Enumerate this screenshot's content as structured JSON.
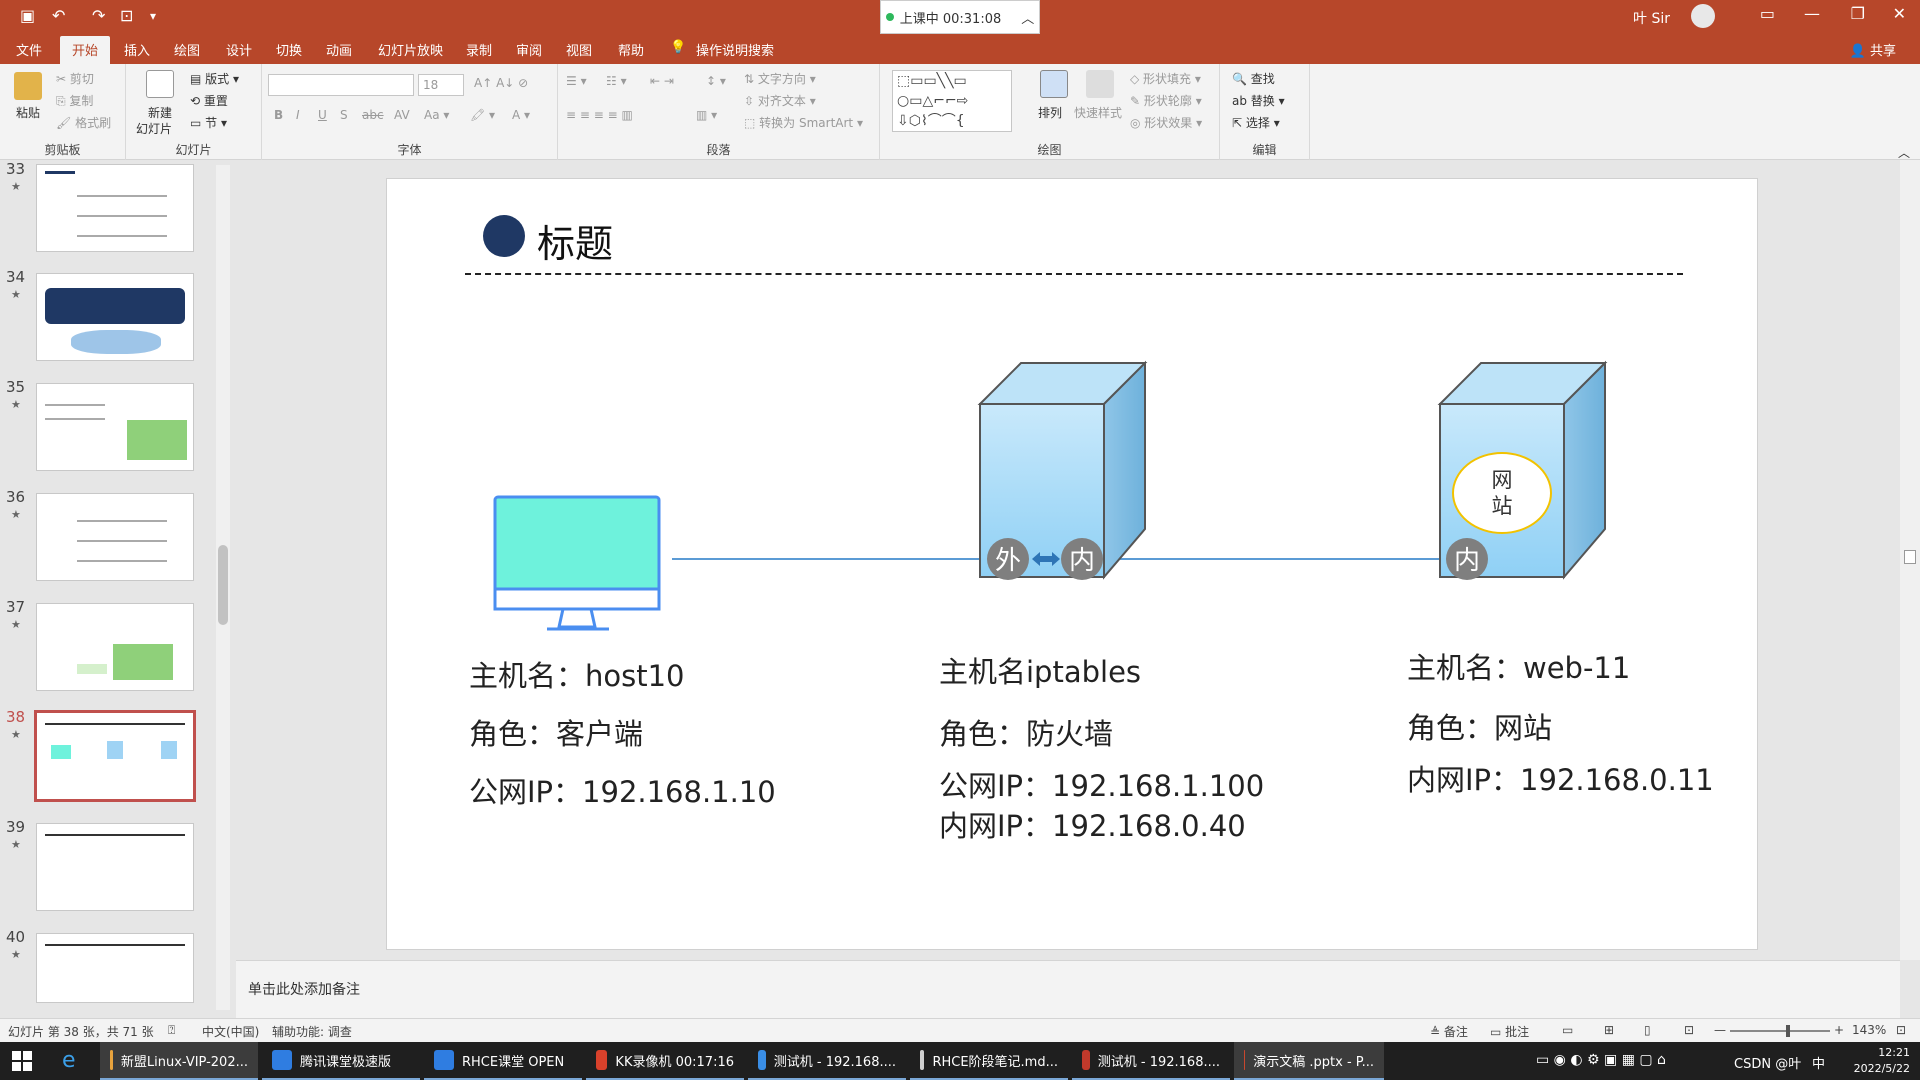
{
  "titlebar": {
    "live_label": "上课中 00:31:08",
    "user_name": "叶 Sir"
  },
  "menu_tabs": [
    {
      "label": "文件"
    },
    {
      "label": "开始"
    },
    {
      "label": "插入"
    },
    {
      "label": "绘图"
    },
    {
      "label": "设计"
    },
    {
      "label": "切换"
    },
    {
      "label": "动画"
    },
    {
      "label": "幻灯片放映"
    },
    {
      "label": "录制"
    },
    {
      "label": "审阅"
    },
    {
      "label": "视图"
    },
    {
      "label": "帮助"
    },
    {
      "label": "操作说明搜索"
    }
  ],
  "share_label": "共享",
  "ribbon": {
    "clipboard": {
      "paste": "粘贴",
      "cut": "剪切",
      "copy": "复制",
      "format_painter": "格式刷",
      "title": "剪贴板"
    },
    "slides": {
      "new_slide": "新建",
      "new_slide2": "幻灯片",
      "layout": "版式",
      "reset": "重置",
      "section": "节",
      "title": "幻灯片"
    },
    "font": {
      "size": "18",
      "title": "字体"
    },
    "paragraph": {
      "text_direction": "文字方向",
      "align_text": "对齐文本",
      "smartart": "转换为 SmartArt",
      "title": "段落"
    },
    "drawing": {
      "arrange": "排列",
      "quick_styles": "快速样式",
      "fill": "形状填充",
      "outline": "形状轮廓",
      "effects": "形状效果",
      "title": "绘图"
    },
    "editing": {
      "find": "查找",
      "replace": "替换",
      "select": "选择",
      "title": "编辑"
    }
  },
  "thumbnails": [
    {
      "number": "33"
    },
    {
      "number": "34"
    },
    {
      "number": "35"
    },
    {
      "number": "36"
    },
    {
      "number": "37"
    },
    {
      "number": "38"
    },
    {
      "number": "39"
    },
    {
      "number": "40"
    }
  ],
  "slide": {
    "title": "标题",
    "hosts": [
      {
        "name": "主机名：host10",
        "role": "角色：客户端",
        "ip1": "公网IP：192.168.1.10",
        "ip2": ""
      },
      {
        "name": "主机名iptables",
        "role": "角色：防火墙",
        "ip1": "公网IP：192.168.1.100",
        "ip2": "内网IP：192.168.0.40"
      },
      {
        "name": "主机名：web-11",
        "role": "角色：网站",
        "ip1": "内网IP：192.168.0.11",
        "ip2": ""
      }
    ],
    "firewall_outer": "外",
    "firewall_inner": "内",
    "web_inner": "内",
    "website_label_1": "网",
    "website_label_2": "站"
  },
  "notes_placeholder": "单击此处添加备注",
  "status": {
    "slide_info": "幻灯片 第 38 张，共 71 张",
    "language": "中文(中国)",
    "accessibility": "辅助功能: 调查",
    "notes": "备注",
    "comments": "批注",
    "zoom": "143%"
  },
  "taskbar": [
    {
      "label": "新盟Linux-VIP-202...",
      "color": "#e8a33d"
    },
    {
      "label": "腾讯课堂极速版",
      "color": "#2f7de1"
    },
    {
      "label": "RHCE课堂 OPEN",
      "color": "#2f7de1"
    },
    {
      "label": "KK录像机 00:17:16",
      "color": "#d9412b"
    },
    {
      "label": "测试机 - 192.168....",
      "color": "#3a8ee6"
    },
    {
      "label": "RHCE阶段笔记.md...",
      "color": "#d0d0d0"
    },
    {
      "label": "测试机 - 192.168....",
      "color": "#c0392b"
    },
    {
      "label": "演示文稿 .pptx - P...",
      "color": "#c8472e"
    }
  ],
  "tray": {
    "time": "12:21",
    "date": "2022/5/22",
    "ime": "CSDN @叶",
    "ime2": "中"
  }
}
